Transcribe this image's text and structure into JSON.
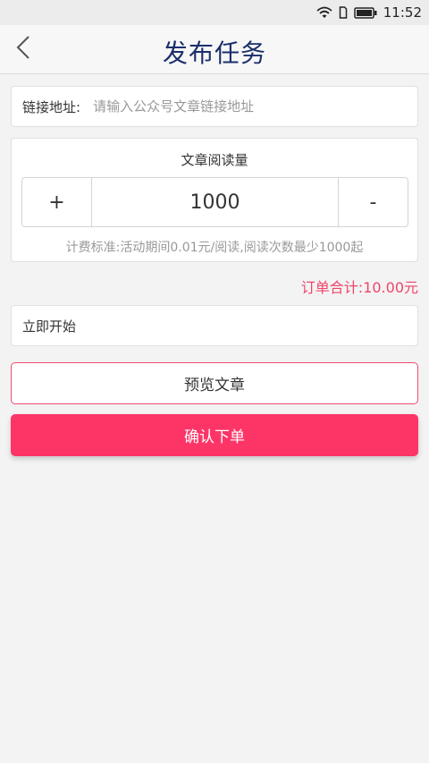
{
  "status_bar": {
    "time": "11:52",
    "icons": [
      "wifi-icon",
      "sim-icon",
      "battery-icon"
    ]
  },
  "header": {
    "back_icon": "chevron-left-icon",
    "title": "发布任务"
  },
  "link_field": {
    "label": "链接地址:",
    "placeholder": "请输入公众号文章链接地址",
    "value": ""
  },
  "read_volume": {
    "title": "文章阅读量",
    "plus_label": "+",
    "value": "1000",
    "minus_label": "-",
    "fee_note": "计费标准:活动期间0.01元/阅读,阅读次数最少1000起"
  },
  "order_total": "订单合计:10.00元",
  "start_option": "立即开始",
  "preview_button": "预览文章",
  "confirm_button": "确认下单",
  "colors": {
    "title": "#1a2f6b",
    "accent": "#fd3567",
    "total_text": "#f0446a",
    "background": "#f3f3f3"
  }
}
